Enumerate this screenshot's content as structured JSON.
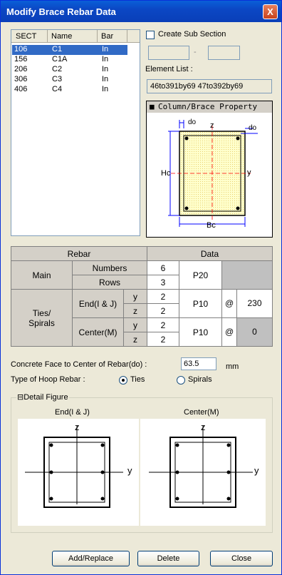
{
  "window": {
    "title": "Modify Brace Rebar Data",
    "close_glyph": "X"
  },
  "list": {
    "columns": [
      "SECT",
      "Name",
      "Bar"
    ],
    "rows": [
      {
        "sect": "106",
        "name": "C1",
        "bar": "In"
      },
      {
        "sect": "156",
        "name": "C1A",
        "bar": "In"
      },
      {
        "sect": "206",
        "name": "C2",
        "bar": "In"
      },
      {
        "sect": "306",
        "name": "C3",
        "bar": "In"
      },
      {
        "sect": "406",
        "name": "C4",
        "bar": "In"
      }
    ]
  },
  "sub_section": {
    "label": "Create Sub Section",
    "from": "",
    "to": "",
    "dash": "-"
  },
  "element_list": {
    "label": "Element List :",
    "value": "46to391by69 47to392by69"
  },
  "property": {
    "title": "Column/Brace Property",
    "labels": {
      "do_top": "do",
      "do_right": "do",
      "z": "z",
      "y": "y",
      "hc": "Hc",
      "bc": "Bc"
    }
  },
  "table": {
    "rebar": "Rebar",
    "data": "Data",
    "main": "Main",
    "numbers": "Numbers",
    "rows": "Rows",
    "numbers_val": "6",
    "rows_val": "3",
    "main_bar": "P20",
    "ties": "Ties/",
    "spirals": "Spirals",
    "end": "End(I & J)",
    "center": "Center(M)",
    "y": "y",
    "z": "z",
    "end_y": "2",
    "end_z": "2",
    "center_y": "2",
    "center_z": "2",
    "end_bar": "P10",
    "center_bar": "P10",
    "at": "@",
    "end_spacing": "230",
    "center_spacing": "0"
  },
  "concrete": {
    "label": "Concrete Face to Center of Rebar(do) :",
    "value": "63.5",
    "unit": "mm"
  },
  "hoop": {
    "label": "Type of Hoop Rebar :",
    "ties": "Ties",
    "spirals": "Spirals",
    "selected": "Ties"
  },
  "detail": {
    "toggle": "⊟",
    "label": "Detail Figure",
    "end_title": "End(I & J)",
    "center_title": "Center(M)",
    "z": "z",
    "y": "y"
  },
  "buttons": {
    "add": "Add/Replace",
    "delete": "Delete",
    "close": "Close"
  }
}
